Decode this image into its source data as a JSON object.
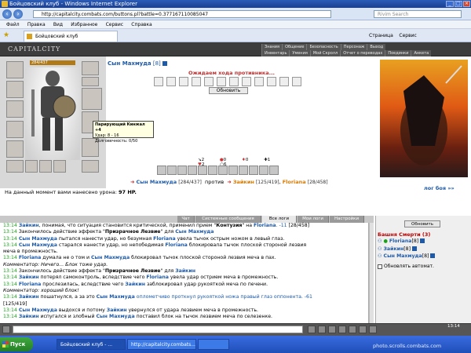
{
  "window": {
    "title": "Бойцовский клуб - Windows Internet Explorer"
  },
  "address": {
    "url": "http://capitalcity.combats.com/buttons.pl?battle=0.377167110085047",
    "search_placeholder": "Rivim Search"
  },
  "menu": [
    "Файл",
    "Правка",
    "Вид",
    "Избранное",
    "Сервис",
    "Справка"
  ],
  "tab": {
    "label": "Бойцовский клуб"
  },
  "tab_tools": {
    "page": "Страница",
    "tools": "Сервис"
  },
  "game": {
    "logo": "CAPITALCITY",
    "nav_top": [
      "Знания",
      "Общение",
      "Безопасность",
      "Персонаж",
      "Выход"
    ],
    "nav_bottom": [
      "Инвентарь",
      "Умения",
      "Мой Скролл",
      "Отчет о переводах",
      "Поединки",
      "Анкета"
    ],
    "player": {
      "name": "Сын Махмуда",
      "level": "[8]",
      "hp": "284/437"
    },
    "tooltip": {
      "title": "Парирующий Кинжал +4",
      "line1": "Удар: 8 - 16",
      "line2": "Долговечность: 0/50"
    },
    "waiting": "Ожидаем хода противника...",
    "refresh": "Обновить",
    "stats": [
      {
        "icon": "arrow",
        "value": "2"
      },
      {
        "icon": "fire",
        "value": "0"
      },
      {
        "icon": "drop",
        "value": "0"
      },
      {
        "icon": "cross",
        "value": "1"
      },
      {
        "icon": "heart",
        "value": "2"
      },
      {
        "icon": "zero",
        "value": "6"
      }
    ],
    "versus": {
      "left_name": "Сын Махмуда",
      "left_hp": "[284/437]",
      "word": "против",
      "right1_name": "Зайкин",
      "right1_hp": "[125/419]",
      "right2_name": "Floriana",
      "right2_hp": "[28/458]"
    },
    "damage": {
      "text": "На данный момент вами нанесено урона:",
      "value": "97 HP."
    },
    "battle_log_link": "лог боя »»"
  },
  "chat_tabs": [
    "Чат",
    "Системные сообщения",
    "Все логи",
    "Мои логи",
    "Настройки"
  ],
  "chat": [
    {
      "time": "13:14",
      "parts": [
        [
          "Зайкин",
          "blue"
        ],
        [
          ", понимая, что ситуация становится критической, применил прием \"",
          ""
        ],
        [
          "Контузия",
          "bold"
        ],
        [
          "\" на ",
          ""
        ],
        [
          "Floriana",
          "blue"
        ],
        [
          ". -11",
          "dmg"
        ],
        [
          " [28/458]",
          ""
        ]
      ]
    },
    {
      "time": "13:14",
      "parts": [
        [
          "Закончилось действие эффекта \"",
          ""
        ],
        [
          "Призрачное Лезвие",
          "bold"
        ],
        [
          "\" для ",
          ""
        ],
        [
          "Сын Махмуда",
          "blue"
        ]
      ]
    },
    {
      "time": "13:14",
      "parts": [
        [
          "Сын Махмуда",
          "blue"
        ],
        [
          " пытался нанести удар, но безумная ",
          ""
        ],
        [
          "Floriana",
          "blue"
        ],
        [
          " увела тычок острым ножом в левый глаз.",
          ""
        ]
      ]
    },
    {
      "time": "13:14",
      "parts": [
        [
          "Сын Махмуда",
          "blue"
        ],
        [
          " старался нанести удар, но непобедимая ",
          ""
        ],
        [
          "Floriana",
          "blue"
        ],
        [
          " блокировала тычок плоской стороной лезвия",
          ""
        ]
      ]
    },
    {
      "time": "",
      "parts": [
        [
          "меча в промежность.",
          ""
        ]
      ]
    },
    {
      "time": "13:14",
      "parts": [
        [
          "Floriana",
          "blue"
        ],
        [
          " думала не о том и ",
          ""
        ],
        [
          "Сын Махмуда",
          "blue"
        ],
        [
          " блокировал тычок плоской стороной лезвия меча в пах.",
          ""
        ]
      ]
    },
    {
      "time": "",
      "parts": [
        [
          "Комментатор: Ничего... Блок тоже удар.",
          "italic"
        ]
      ]
    },
    {
      "time": "13:14",
      "parts": [
        [
          "Закончилось действие эффекта \"",
          ""
        ],
        [
          "Призрачное Лезвие",
          "bold"
        ],
        [
          "\" для ",
          ""
        ],
        [
          "Зайкин",
          "blue"
        ]
      ]
    },
    {
      "time": "13:14",
      "parts": [
        [
          "Зайкин",
          "blue"
        ],
        [
          " потерял самоконтроль, вследствие чего ",
          ""
        ],
        [
          "Floriana",
          "blue"
        ],
        [
          " увела удар острием меча в промежность.",
          ""
        ]
      ]
    },
    {
      "time": "13:14",
      "parts": [
        [
          "Floriana",
          "blue"
        ],
        [
          " прослезилась, вследствие чего ",
          ""
        ],
        [
          "Зайкин",
          "blue"
        ],
        [
          " заблокировал удар рукояткой меча по печени.",
          ""
        ]
      ]
    },
    {
      "time": "",
      "parts": [
        [
          "Комментатор: хороший блок!",
          "italic"
        ]
      ]
    },
    {
      "time": "13:14",
      "parts": [
        [
          "Зайкин",
          "blue"
        ],
        [
          " пошатнулся, а за это ",
          ""
        ],
        [
          "Сын Махмуда",
          "blue"
        ],
        [
          " оплометчиво проткнул рукояткой ножа правый глаз оппонента. -61",
          "dmg"
        ]
      ]
    },
    {
      "time": "",
      "parts": [
        [
          "[125/419]",
          ""
        ]
      ]
    },
    {
      "time": "13:14",
      "parts": [
        [
          "Сын Махмуда",
          "blue"
        ],
        [
          " выдохся и потому ",
          ""
        ],
        [
          "Зайкин",
          "blue"
        ],
        [
          " увернулся от удара лезвием меча в промежность.",
          ""
        ]
      ]
    },
    {
      "time": "13:14",
      "parts": [
        [
          "Зайкин",
          "blue"
        ],
        [
          " испугался и злобный ",
          ""
        ],
        [
          "Сын Махмуда",
          "blue"
        ],
        [
          " поставил блок на тычок лезвием меча по селезенке.",
          ""
        ]
      ]
    }
  ],
  "right_chat": {
    "refresh": "Обновить",
    "room": "Башня Смерти (3)",
    "users": [
      {
        "name": "Floriana",
        "level": "[8]"
      },
      {
        "name": "Зайкин",
        "level": "[8]"
      },
      {
        "name": "Сын Махмуда",
        "level": "[8]"
      }
    ],
    "auto_refresh": "Обновлять автомат."
  },
  "bottom": {
    "clock": "13:14"
  },
  "taskbar": {
    "start": "Пуск",
    "tasks": [
      "Бойцовский клуб - ...",
      "http://capitalcity.combats...",
      ""
    ]
  },
  "watermark": "photo.scrolls.combats.com",
  "colors": {
    "accent_blue": "#1e5aa8",
    "time_green": "#16a316",
    "enemy_orange": "#d97a00",
    "room_red": "#b00000"
  }
}
